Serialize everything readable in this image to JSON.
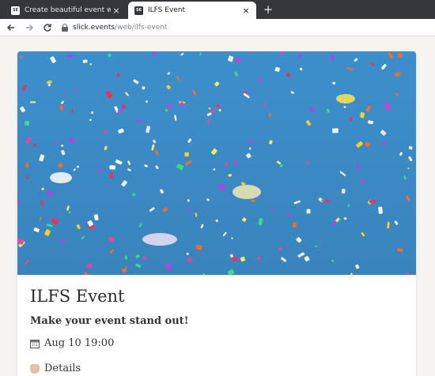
{
  "browser": {
    "tabs": [
      {
        "title": "Create beautiful event websites",
        "favicon": "SE",
        "active": false
      },
      {
        "title": "ILFS Event",
        "favicon": "SE",
        "active": true
      }
    ],
    "close_glyph": "×",
    "new_tab_glyph": "+",
    "url_host": "slick.events",
    "url_path": "/web/ilfs-event"
  },
  "event": {
    "title": "ILFS Event",
    "tagline": "Make your event stand out!",
    "date": "Aug 10 19:00",
    "details_label": "Details"
  },
  "hero": {
    "image": "confetti-photo",
    "sky_color": "#3b8ec9"
  }
}
